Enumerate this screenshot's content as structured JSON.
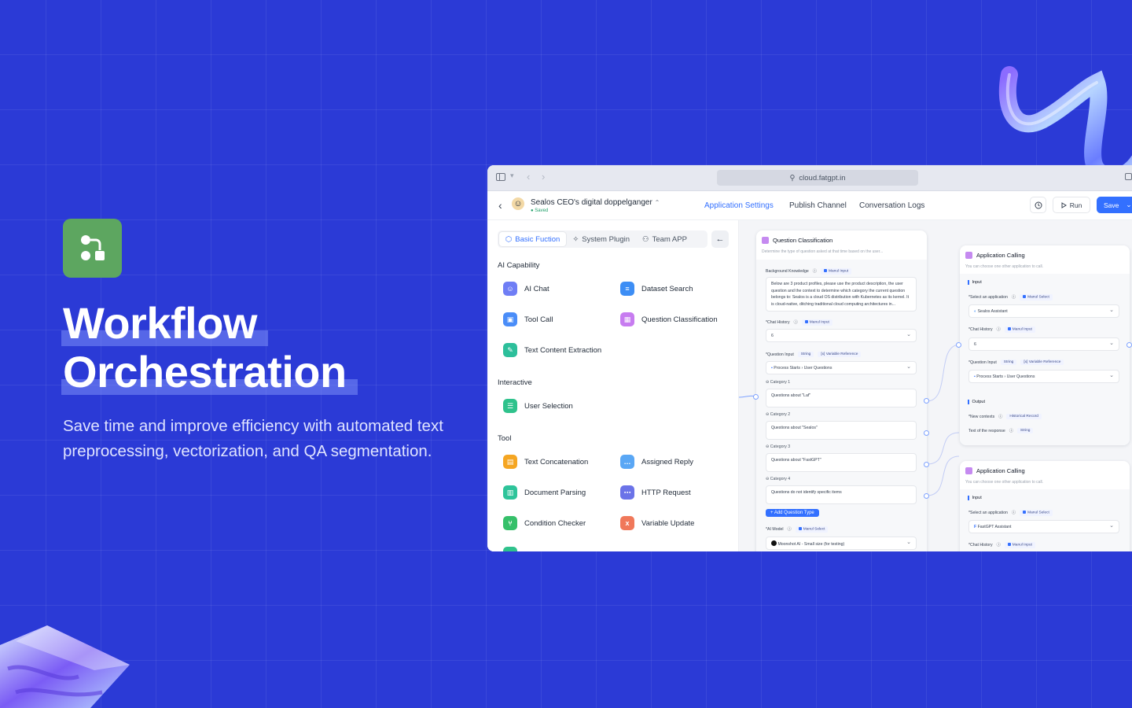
{
  "hero": {
    "title_line1": "Workflow",
    "title_line2": "Orchestration",
    "subtitle": "Save time and improve efficiency with automated text preprocessing, vectorization, and QA segmentation."
  },
  "browser": {
    "url": "cloud.fatgpt.in"
  },
  "app": {
    "name": "Sealos CEO's digital doppelganger",
    "status": "Saved",
    "tabs": [
      "Application Settings",
      "Publish Channel",
      "Conversation Logs"
    ],
    "run_label": "Run",
    "save_label": "Save"
  },
  "panel": {
    "tabs": [
      "Basic Fuction",
      "System Plugin",
      "Team APP"
    ],
    "sections": [
      {
        "title": "AI Capability",
        "items": [
          {
            "label": "AI Chat",
            "color": "#6f7ef5",
            "icon": "robot-icon"
          },
          {
            "label": "Dataset Search",
            "color": "#3d8ef5",
            "icon": "database-icon"
          },
          {
            "label": "Tool Call",
            "color": "#4a8df8",
            "icon": "toolbox-icon"
          },
          {
            "label": "Question Classification",
            "color": "#c77cf0",
            "icon": "classify-icon"
          },
          {
            "label": "Text Content Extraction",
            "color": "#2dbf9b",
            "icon": "extract-icon"
          }
        ]
      },
      {
        "title": "Interactive",
        "items": [
          {
            "label": "User Selection",
            "color": "#2fc28c",
            "icon": "selection-icon"
          }
        ]
      },
      {
        "title": "Tool",
        "items": [
          {
            "label": "Text Concatenation",
            "color": "#f5a623",
            "icon": "concat-icon"
          },
          {
            "label": "Assigned Reply",
            "color": "#5aa7f5",
            "icon": "reply-icon"
          },
          {
            "label": "Document Parsing",
            "color": "#2ec49a",
            "icon": "document-icon"
          },
          {
            "label": "HTTP Request",
            "color": "#6b73e8",
            "icon": "http-icon"
          },
          {
            "label": "Condition Checker",
            "color": "#36c06a",
            "icon": "branch-icon"
          },
          {
            "label": "Variable Update",
            "color": "#f0785a",
            "icon": "variable-icon"
          }
        ]
      }
    ]
  },
  "qc_node": {
    "title": "Question Classification",
    "desc": "Determine the type of question asked at that time based on the user...",
    "bg_label": "Background Knowledge",
    "manual_input": "Manul Input",
    "bg_text": "Below are 3 product profiles, please use the product description, the user question and the context to determine which category the current question belongs to: Sealos is a cloud OS distribution with Kubernetes as its kernel. It is cloud-native, ditching traditional cloud computing architectures in...",
    "chat_history_label": "Chat History",
    "chat_history_value": "6",
    "question_input_label": "Question Input",
    "string_tag": "String",
    "variable_reference": "Variable Reference",
    "process_starts": "Process Starts",
    "user_questions": "User Questions",
    "categories": [
      {
        "label": "Category 1",
        "value": "Questions about \"Laf\""
      },
      {
        "label": "Category 2",
        "value": "Questions about \"Sealos\""
      },
      {
        "label": "Category 3",
        "value": "Questions about \"FastGPT\""
      },
      {
        "label": "Category 4",
        "value": "Questions do not identify specific items"
      }
    ],
    "add_button": "+ Add Question Type",
    "ai_model_label": "AI Model",
    "manual_select": "Manul Select",
    "ai_model_value": "Moonshot AI - Small size (for testing)"
  },
  "app_call_1": {
    "title": "Application Calling",
    "desc": "You can choose one other application to call.",
    "input_h": "Input",
    "select_app_label": "Select an application",
    "manual_select": "Manul Select",
    "app_value": "Sealos Assistant",
    "chat_history_label": "Chat History",
    "manual_input": "Manul Input",
    "chat_history_value": "6",
    "question_input_label": "Question Input",
    "string_tag": "String",
    "variable_reference": "Variable Reference",
    "process_starts": "Process Starts",
    "user_questions": "User Questions",
    "output_h": "Output",
    "new_contexts_label": "New contexts",
    "historical_record": "Historical Record",
    "response_label": "Text of the response",
    "response_type": "String"
  },
  "app_call_2": {
    "title": "Application Calling",
    "desc": "You can choose one other application to call.",
    "input_h": "Input",
    "select_app_label": "Select an application",
    "manual_select": "Manul Select",
    "app_value": "FastGPT Assistant",
    "chat_history_label": "Chat History",
    "manual_input": "Manul Input"
  }
}
